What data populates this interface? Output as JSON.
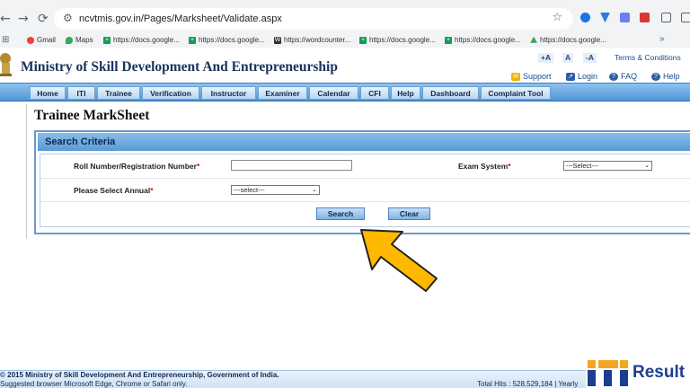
{
  "browser": {
    "url": "ncvtmis.gov.in/Pages/Marksheet/Validate.aspx",
    "bookmarks": [
      {
        "label": "Gmail",
        "icon": "gmail-icon"
      },
      {
        "label": "Maps",
        "icon": "maps-icon"
      },
      {
        "label": "https://docs.google...",
        "icon": "docs-icon"
      },
      {
        "label": "https://docs.google...",
        "icon": "docs-icon"
      },
      {
        "label": "https://wordcounter...",
        "icon": "wordcounter-icon"
      },
      {
        "label": "https://docs.google...",
        "icon": "docs-icon"
      },
      {
        "label": "https://docs.google...",
        "icon": "docs-icon"
      },
      {
        "label": "https://docs.google...",
        "icon": "drive-icon"
      }
    ],
    "more_bookmarks": "»"
  },
  "site": {
    "title": "Ministry of Skill Development And Entrepreneurship",
    "font_plus": "+A",
    "font_normal": "A",
    "font_minus": "-A",
    "terms": "Terms & Conditions",
    "support": "Support",
    "login": "Login",
    "faq": "FAQ",
    "help": "Help"
  },
  "menu": [
    "Home",
    "ITI",
    "Trainee",
    "Verification",
    "Instructor",
    "Examiner",
    "Calendar",
    "CFI",
    "Help",
    "Dashboard",
    "Complaint Tool"
  ],
  "page": {
    "title": "Trainee MarkSheet",
    "panel_title": "Search Criteria",
    "roll_label": "Roll Number/Registration Number",
    "exam_label": "Exam System",
    "annual_label": "Please Select Annual",
    "required_mark": "*",
    "exam_selected": "---Select---",
    "annual_selected": "---select---",
    "search_button": "Search",
    "clear_button": "Clear"
  },
  "footer": {
    "copyright": "© 2015 Ministry of Skill Development And Entrepreneurship, Government of India.",
    "browser_note": "Suggested browser Microsoft Edge, Chrome or Safari only.",
    "hits": "Total Hits : 528,529,184 | Yearly"
  },
  "watermark": {
    "logo_text": "Result",
    "logo_letters": "ITI",
    "colors": {
      "orange": "#f5a623",
      "blue": "#1b3f8f"
    }
  },
  "colors": {
    "menu_blue": "#5fa2dc",
    "title_navy": "#18335c",
    "arrow_yellow": "#ffb800"
  }
}
